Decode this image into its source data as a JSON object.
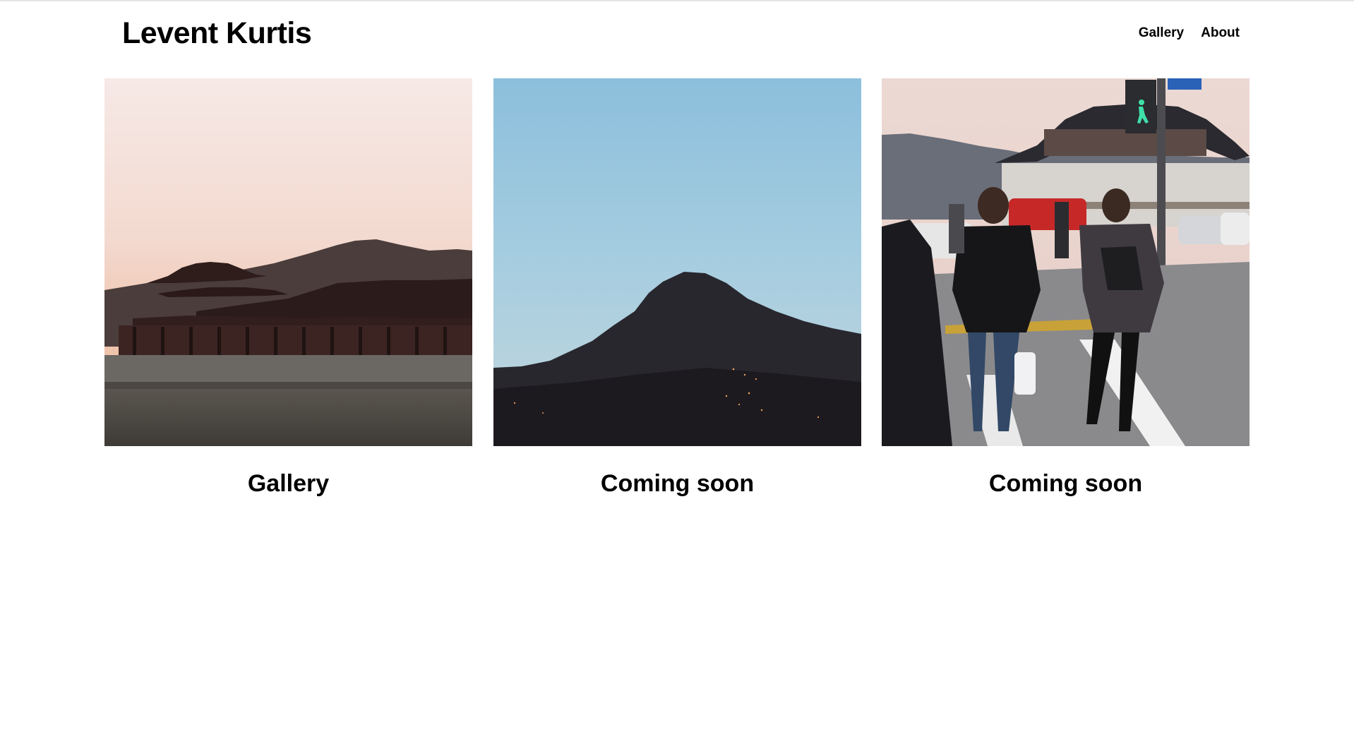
{
  "site": {
    "title": "Levent Kurtis"
  },
  "nav": {
    "items": [
      {
        "label": "Gallery"
      },
      {
        "label": "About"
      }
    ]
  },
  "cards": [
    {
      "caption": "Gallery",
      "image_icon": "palace-sunset-photo"
    },
    {
      "caption": "Coming soon",
      "image_icon": "mountain-dusk-photo"
    },
    {
      "caption": "Coming soon",
      "image_icon": "street-crossing-photo"
    }
  ],
  "colors": {
    "background": "#ffffff",
    "text": "#000000",
    "top_rule": "#e4e4e4"
  }
}
